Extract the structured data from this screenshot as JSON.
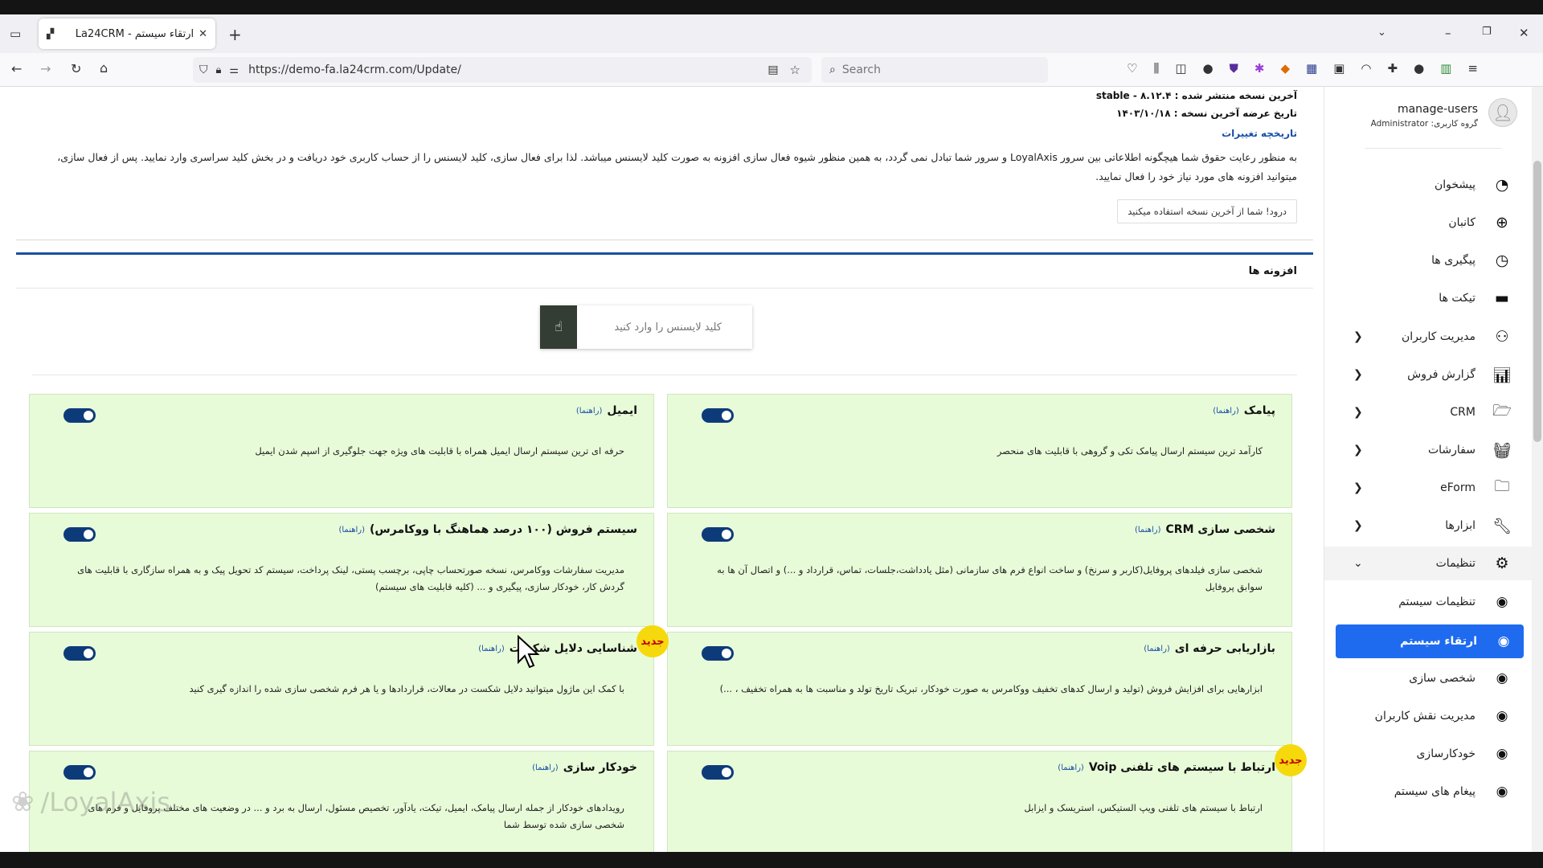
{
  "browser": {
    "tab_title": "ارتقاء سیستم - La24CRM",
    "url": "https://demo-fa.la24crm.com/Update/",
    "search_placeholder": "Search",
    "new_tab": "+",
    "close_tab": "✕"
  },
  "header": {
    "latest_version_label": "آخرین نسخه منتشر شده :",
    "latest_version_value": "stable - ۸.۱۲.۴",
    "release_date_label": "تاریخ عرضه آخرین نسخه :",
    "release_date_value": "۱۴۰۳/۱۰/۱۸",
    "changelog_link": "تاریخچه تغییرات",
    "notice_line1": "به منظور رعایت حقوق شما هیچگونه اطلاعاتی بین سرور LoyalAxis و سرور شما تبادل نمی گردد، به همین منظور شیوه فعال سازی افزونه به صورت کلید لایسنس میباشد. لذا برای فعال سازی، کلید لایسنس را از حساب کاربری خود دریافت و در بخش کلید سراسری وارد نمایید. پس از فعال سازی،",
    "notice_line2": "میتوانید افزونه های مورد نیاز خود را فعال نمایید.",
    "up_to_date_button": "درود! شما از آخرین نسخه استفاده میکنید"
  },
  "plugins": {
    "section_title": "افزونه ها",
    "license_placeholder": "کلید لایسنس را وارد کنید",
    "help_label": "(راهنما)",
    "new_badge": "جدید",
    "items": [
      {
        "title": "پیامک",
        "desc": "کارآمد ترین سیستم ارسال پیامک تکی و گروهی با قابلیت های منحصر"
      },
      {
        "title": "ایمیل",
        "desc": "حرفه ای ترین سیستم ارسال ایمیل همراه با قابلیت های ویژه جهت جلوگیری از اسپم شدن ایمیل"
      },
      {
        "title": "شخصی سازی CRM",
        "desc": "شخصی سازی فیلدهای پروفایل(کاربر و سرنخ) و ساخت انواع فرم های سازمانی (مثل یادداشت،جلسات، تماس، قرارداد و ...) و اتصال آن ها به سوابق پروفایل"
      },
      {
        "title": "سیستم فروش (۱۰۰ درصد هماهنگ با ووکامرس)",
        "desc": "مدیریت سفارشات ووکامرس، نسخه صورتحساب چاپی، برچسب پستی، لینک پرداخت، سیستم کد تحویل پیک و به همراه سازگاری با قابلیت های گردش کار، خودکار سازی، پیگیری و ... (کلیه قابلیت های سیستم)"
      },
      {
        "title": "بازاریابی حرفه ای",
        "desc": "ابزارهایی برای افزایش فروش (تولید و ارسال کدهای تخفیف ووکامرس به صورت خودکار، تبریک تاریخ تولد و مناسبت ها به همراه تخفیف ، ...)"
      },
      {
        "title": "شناسایی دلایل شکست",
        "desc": "با کمک این ماژول میتوانید دلایل شکست در معالات، قراردادها و یا هر فرم شخصی سازی شده را اندازه گیری کنید"
      },
      {
        "title": "ارتباط با سیستم های تلفنی Voip",
        "desc": "ارتباط با سیستم های تلفنی ویپ الستیکس، استریسک و ایزابل"
      },
      {
        "title": "خودکار سازی",
        "desc": "رویدادهای خودکار از جمله ارسال پیامک، ایمیل، تیکت، یادآور، تخصیص مسئول، ارسال به برد و ... در وضعیت های مختلف پروفایل و فرم های شخصی سازی شده توسط شما"
      }
    ]
  },
  "sidebar": {
    "username": "manage-users",
    "role": "گروه کاربری: Administrator",
    "items": [
      {
        "label": "پیشخوان",
        "icon": "gauge-icon"
      },
      {
        "label": "کانبان",
        "icon": "kanban-icon"
      },
      {
        "label": "پیگیری ها",
        "icon": "clock-icon"
      },
      {
        "label": "تیکت ها",
        "icon": "ticket-icon"
      },
      {
        "label": "مدیریت کاربران",
        "icon": "users-icon"
      },
      {
        "label": "گزارش فروش",
        "icon": "chart-icon"
      },
      {
        "label": "CRM",
        "icon": "folder-open-icon"
      },
      {
        "label": "سفارشات",
        "icon": "basket-icon"
      },
      {
        "label": "eForm",
        "icon": "folder-icon"
      },
      {
        "label": "ابزارها",
        "icon": "wrench-icon"
      },
      {
        "label": "تنظیمات",
        "icon": "gear-icon"
      }
    ],
    "subitems": [
      {
        "label": "تنظیمات سیستم"
      },
      {
        "label": "ارتقاء سیستم"
      },
      {
        "label": "شخصی سازی"
      },
      {
        "label": "مدیریت نقش کاربران"
      },
      {
        "label": "خودکارسازی"
      },
      {
        "label": "پیغام های سیستم"
      }
    ]
  },
  "watermark": "LoyalAxis"
}
